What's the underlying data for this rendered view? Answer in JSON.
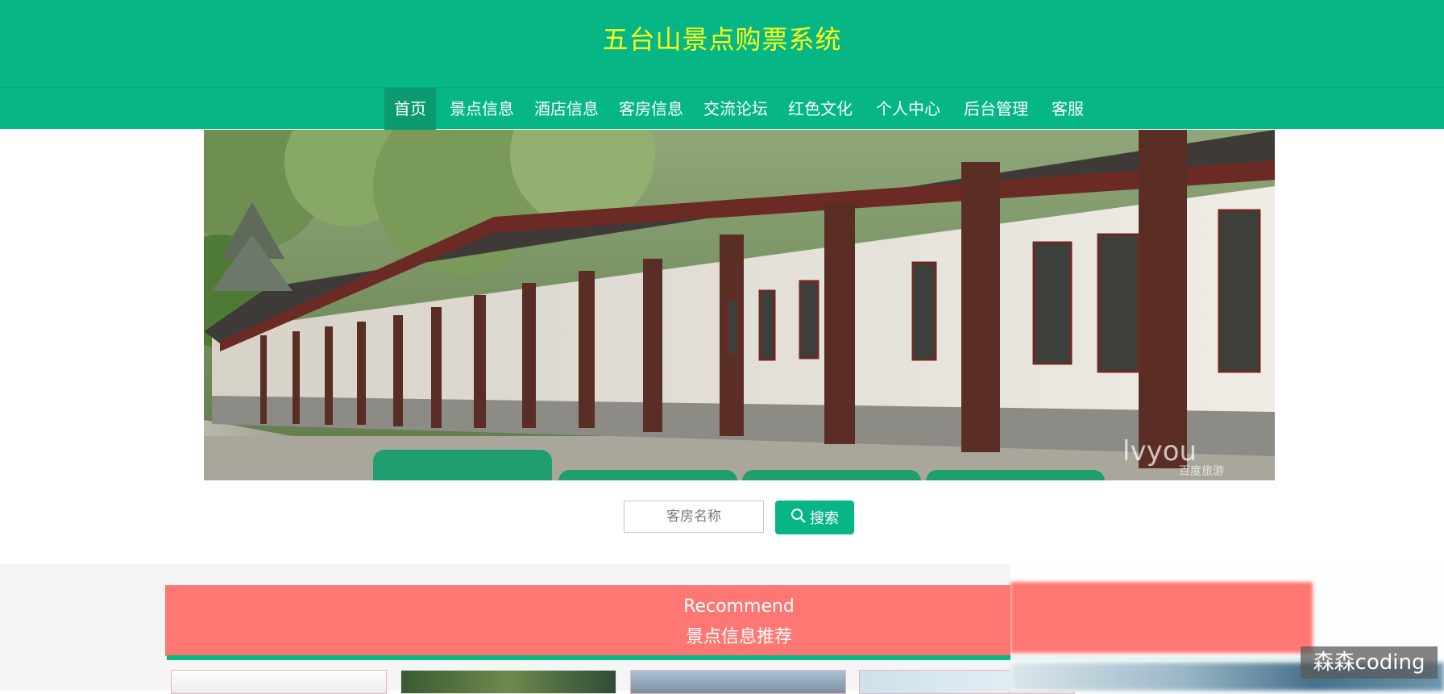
{
  "header": {
    "title": "五台山景点购票系统",
    "bg_color": "#06b785",
    "title_color": "#ffff1a"
  },
  "nav": {
    "items": [
      {
        "label": "首页",
        "active": true
      },
      {
        "label": "景点信息"
      },
      {
        "label": "酒店信息"
      },
      {
        "label": "客房信息"
      },
      {
        "label": "交流论坛"
      },
      {
        "label": "红色文化"
      },
      {
        "label": "个人中心"
      },
      {
        "label": "后台管理"
      },
      {
        "label": "客服"
      }
    ]
  },
  "banner": {
    "image": "chinese-corridor-photo",
    "watermark_text": "lvyou",
    "watermark_sub": "百度旅游",
    "slides": 4,
    "active_slide": 1
  },
  "search": {
    "placeholder": "客房名称",
    "button_label": "搜索",
    "icon": "search-icon"
  },
  "recommend": {
    "title_en": "Recommend",
    "title_cn": "景点信息推荐",
    "bg_color": "#ff7773"
  },
  "overlay": {
    "watermark": "森森coding"
  }
}
